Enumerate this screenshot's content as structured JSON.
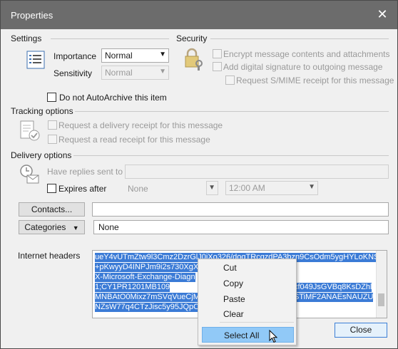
{
  "window": {
    "title": "Properties",
    "close_glyph": "✕"
  },
  "settings": {
    "heading": "Settings",
    "importance_label": "Importance",
    "importance_value": "Normal",
    "sensitivity_label": "Sensitivity",
    "sensitivity_value": "Normal",
    "autoarchive_label": "Do not AutoArchive this item"
  },
  "security": {
    "heading": "Security",
    "encrypt_label": "Encrypt message contents and attachments",
    "signature_label": "Add digital signature to outgoing message",
    "smime_label": "Request S/MIME receipt for this message"
  },
  "tracking": {
    "heading": "Tracking options",
    "delivery_label": "Request a delivery receipt for this message",
    "read_label": "Request a read receipt for this message"
  },
  "delivery": {
    "heading": "Delivery options",
    "replies_label": "Have replies sent to",
    "expires_label": "Expires after",
    "expires_date": "None",
    "expires_time": "12:00 AM"
  },
  "contacts_button": "Contacts...",
  "categories_button": "Categories",
  "categories_value": "None",
  "headers": {
    "label": "Internet headers",
    "lines": [
      "ueY4vUTmZtw9l3Cmz2DzrGlJ0iXo326/doqTRcqzdPA3bzn9CsOdm5ygHYLoKNS",
      "+pKwyyD4INPJm9i2s730XgXy",
      "X-Microsoft-Exchange-Diagn",
      "        1;CY1PR1201MB109",
      "MNBAtO0Mixz7mSVqVueCjM",
      "NZsW77q4CTzJisc5y95JQpOF"
    ],
    "lines_right": [
      "cf049JsGVBq8KsDZhl",
      "STiMF2ANAEsNAUZU"
    ]
  },
  "context_menu": {
    "items": [
      "Cut",
      "Copy",
      "Paste",
      "Clear"
    ],
    "select_all": "Select All"
  },
  "close_button": "Close"
}
